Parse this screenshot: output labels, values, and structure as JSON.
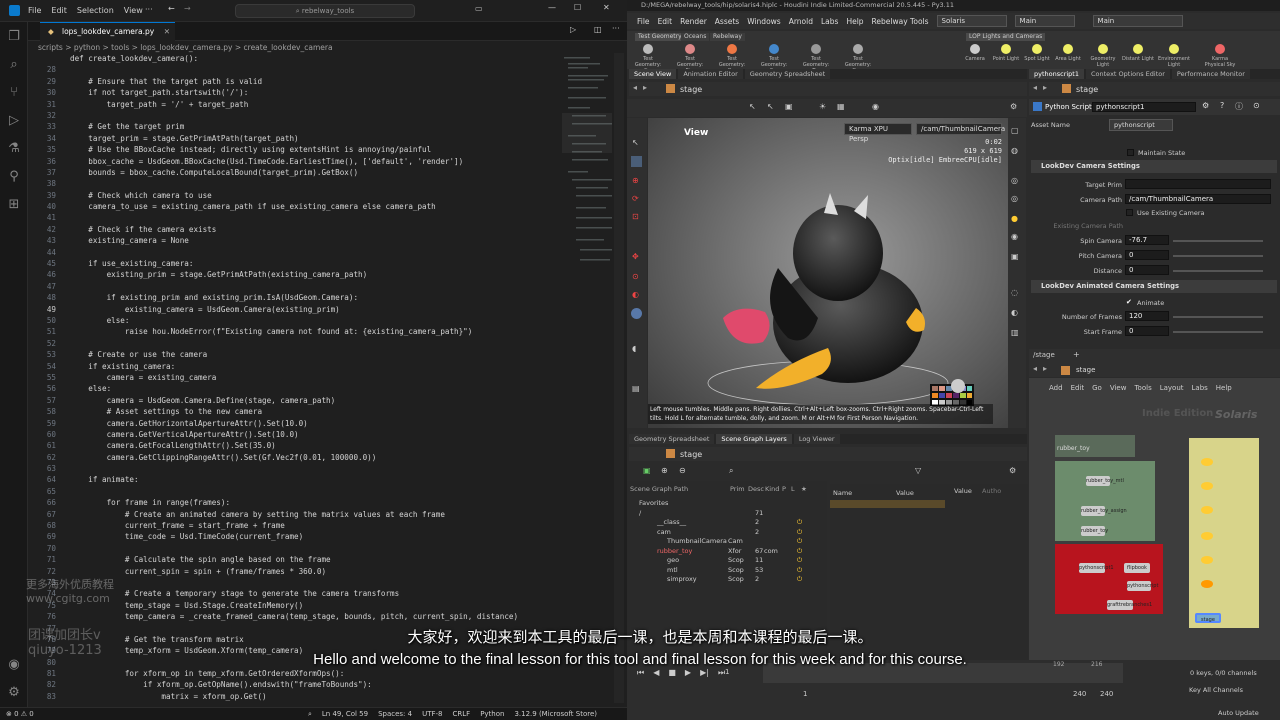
{
  "vscode": {
    "menu": [
      "File",
      "Edit",
      "Selection",
      "View"
    ],
    "search": "rebelway_tools",
    "tab": "lops_lookdev_camera.py",
    "breadcrumb": "scripts > python > tools > lops_lookdev_camera.py > create_lookdev_camera",
    "lines": [
      {
        "n": "",
        "t": "def create_lookdev_camera():"
      },
      {
        "n": "28",
        "t": ""
      },
      {
        "n": "29",
        "t": "    # Ensure that the target path is valid"
      },
      {
        "n": "30",
        "t": "    if not target_path.startswith('/'):"
      },
      {
        "n": "31",
        "t": "        target_path = '/' + target_path"
      },
      {
        "n": "32",
        "t": ""
      },
      {
        "n": "33",
        "t": "    # Get the target prim"
      },
      {
        "n": "34",
        "t": "    target_prim = stage.GetPrimAtPath(target_path)"
      },
      {
        "n": "35",
        "t": "    # Use the BBoxCache instead; directly using extentsHint is annoying/painful"
      },
      {
        "n": "36",
        "t": "    bbox_cache = UsdGeom.BBoxCache(Usd.TimeCode.EarliestTime(), ['default', 'render'])"
      },
      {
        "n": "37",
        "t": "    bounds = bbox_cache.ComputeLocalBound(target_prim).GetBox()"
      },
      {
        "n": "38",
        "t": ""
      },
      {
        "n": "39",
        "t": "    # Check which camera to use"
      },
      {
        "n": "40",
        "t": "    camera_to_use = existing_camera_path if use_existing_camera else camera_path"
      },
      {
        "n": "41",
        "t": ""
      },
      {
        "n": "42",
        "t": "    # Check if the camera exists"
      },
      {
        "n": "43",
        "t": "    existing_camera = None"
      },
      {
        "n": "44",
        "t": ""
      },
      {
        "n": "45",
        "t": "    if use_existing_camera:"
      },
      {
        "n": "46",
        "t": "        existing_prim = stage.GetPrimAtPath(existing_camera_path)"
      },
      {
        "n": "47",
        "t": ""
      },
      {
        "n": "48",
        "t": "        if existing_prim and existing_prim.IsA(UsdGeom.Camera):"
      },
      {
        "n": "49",
        "t": "            existing_camera = UsdGeom.Camera(existing_prim)"
      },
      {
        "n": "50",
        "t": "        else:"
      },
      {
        "n": "51",
        "t": "            raise hou.NodeError(f\"Existing camera not found at: {existing_camera_path}\")"
      },
      {
        "n": "52",
        "t": ""
      },
      {
        "n": "53",
        "t": "    # Create or use the camera"
      },
      {
        "n": "54",
        "t": "    if existing_camera:"
      },
      {
        "n": "55",
        "t": "        camera = existing_camera"
      },
      {
        "n": "56",
        "t": "    else:"
      },
      {
        "n": "57",
        "t": "        camera = UsdGeom.Camera.Define(stage, camera_path)"
      },
      {
        "n": "58",
        "t": "        # Asset settings to the new camera"
      },
      {
        "n": "59",
        "t": "        camera.GetHorizontalApertureAttr().Set(10.0)"
      },
      {
        "n": "60",
        "t": "        camera.GetVerticalApertureAttr().Set(10.0)"
      },
      {
        "n": "61",
        "t": "        camera.GetFocalLengthAttr().Set(35.0)"
      },
      {
        "n": "62",
        "t": "        camera.GetClippingRangeAttr().Set(Gf.Vec2f(0.01, 100000.0))"
      },
      {
        "n": "63",
        "t": ""
      },
      {
        "n": "64",
        "t": "    if animate:"
      },
      {
        "n": "65",
        "t": ""
      },
      {
        "n": "66",
        "t": "        for frame in range(frames):"
      },
      {
        "n": "67",
        "t": "            # Create an animated camera by setting the matrix values at each frame"
      },
      {
        "n": "68",
        "t": "            current_frame = start_frame + frame"
      },
      {
        "n": "69",
        "t": "            time_code = Usd.TimeCode(current_frame)"
      },
      {
        "n": "70",
        "t": ""
      },
      {
        "n": "71",
        "t": "            # Calculate the spin angle based on the frame"
      },
      {
        "n": "72",
        "t": "            current_spin = spin + (frame/frames * 360.0)"
      },
      {
        "n": "73",
        "t": ""
      },
      {
        "n": "74",
        "t": "            # Create a temporary stage to generate the camera transforms"
      },
      {
        "n": "75",
        "t": "            temp_stage = Usd.Stage.CreateInMemory()"
      },
      {
        "n": "76",
        "t": "            temp_camera = _create_framed_camera(temp_stage, bounds, pitch, current_spin, distance)"
      },
      {
        "n": "77",
        "t": ""
      },
      {
        "n": "78",
        "t": "            # Get the transform matrix"
      },
      {
        "n": "79",
        "t": "            temp_xform = UsdGeom.Xform(temp_camera)"
      },
      {
        "n": "80",
        "t": ""
      },
      {
        "n": "81",
        "t": "            for xform_op in temp_xform.GetOrderedXformOps():"
      },
      {
        "n": "82",
        "t": "                if xform_op.GetOpName().endswith(\"frameToBounds\"):"
      },
      {
        "n": "83",
        "t": "                    matrix = xform_op.Get()"
      }
    ],
    "status": {
      "left": "⊗ 0  ⚠ 0",
      "pos": "Ln 49, Col 59",
      "spaces": "Spaces: 4",
      "enc": "UTF-8",
      "eol": "CRLF",
      "lang": "Python",
      "ver": "3.12.9 (Microsoft Store)"
    }
  },
  "houdini": {
    "title": "D:/MEGA/rebelway_tools/hip/solaris4.hiplc - Houdini Indie Limited-Commercial 20.5.445 - Py3.11",
    "menu": [
      "File",
      "Edit",
      "Render",
      "Assets",
      "Windows",
      "Arnold",
      "Labs",
      "Help",
      "Rebelway Tools"
    ],
    "desk": "Solaris",
    "main": "Main",
    "main2": "Main",
    "shelf_tabs": [
      "Test Geometry",
      "Oceans",
      "Rebelway"
    ],
    "shelf_tabs2": [
      "LOP Lights and Cameras"
    ],
    "shelf_tools": [
      "Test Geometry: C...",
      "Test Geometry: Pi...",
      "Test Geometry: R...",
      "Test Geometry: S...",
      "Test Geometry: T...",
      "Test Geometry: Ge..."
    ],
    "shelf_tools2": [
      "Camera",
      "Point Light",
      "Spot Light",
      "Area Light",
      "Geometry Light",
      "Distant Light",
      "Environment Light",
      "Karma Physical Sky"
    ],
    "view_tabs": [
      "Scene View",
      "Animation Editor",
      "Geometry Spreadsheet"
    ],
    "stage": "stage",
    "vp": {
      "label": "View",
      "renderer": "Karma XPU Persp",
      "camera": "/cam/ThumbnailCamera",
      "time": "0:02",
      "res": "619 x 619",
      "status": "Optix[idle]  EmbreeCPU[idle]",
      "help": "Left mouse tumbles. Middle pans. Right dollies. Ctrl+Alt+Left box-zooms. Ctrl+Right zooms. Spacebar-Ctrl-Left tilts. Hold L for alternate tumble, dolly, and zoom. M or Alt+M for First Person Navigation."
    },
    "param_tabs": [
      "pythonscript1",
      "Context Options Editor",
      "Performance Monitor"
    ],
    "params": {
      "node_type": "Python Script",
      "node_name": "pythonscript1",
      "asset_name_label": "Asset Name",
      "asset_name": "pythonscript",
      "maintain_state": "Maintain State",
      "sec1": "LookDev Camera Settings",
      "target_prim_label": "Target Prim",
      "target_prim": "",
      "camera_path_label": "Camera Path",
      "camera_path": "/cam/ThumbnailCamera",
      "use_existing": "Use Existing Camera",
      "existing_path_label": "Existing Camera Path",
      "spin_label": "Spin Camera",
      "spin": "-76.7",
      "pitch_label": "Pitch Camera",
      "pitch": "0",
      "distance_label": "Distance",
      "distance": "0",
      "sec2": "LookDev Animated Camera Settings",
      "animate": "Animate",
      "frames_label": "Number of Frames",
      "frames": "120",
      "start_label": "Start Frame",
      "start": "0"
    },
    "sg_tabs": [
      "Geometry Spreadsheet",
      "Scene Graph Layers",
      "Log Viewer"
    ],
    "sg_header": [
      "Scene Graph Path",
      "Prim",
      "Desc",
      "Kind",
      "P",
      "L",
      "★"
    ],
    "sg_rows": [
      {
        "path": "Favorites",
        "prim": "",
        "desc": "",
        "kind": ""
      },
      {
        "path": "/",
        "prim": "",
        "desc": "71",
        "kind": ""
      },
      {
        "path": "__class__",
        "prim": "",
        "desc": "2",
        "kind": ""
      },
      {
        "path": "cam",
        "prim": "",
        "desc": "2",
        "kind": ""
      },
      {
        "path": "ThumbnailCamera",
        "prim": "Cam",
        "desc": "",
        "kind": ""
      },
      {
        "path": "rubber_toy",
        "prim": "Xfor",
        "desc": "67",
        "kind": "com"
      },
      {
        "path": "geo",
        "prim": "Scop",
        "desc": "11",
        "kind": ""
      },
      {
        "path": "mtl",
        "prim": "Scop",
        "desc": "53",
        "kind": ""
      },
      {
        "path": "simproxy",
        "prim": "Scop",
        "desc": "2",
        "kind": ""
      }
    ],
    "attr_header": [
      "Name",
      "Value",
      "Value",
      "Autho"
    ],
    "net_path": "/stage",
    "net_menu": [
      "Add",
      "Edit",
      "Go",
      "View",
      "Tools",
      "Layout",
      "Labs",
      "Help"
    ],
    "net_watermark": "Indie Edition",
    "net_context": "Solaris",
    "nodes": [
      "rubber_toy",
      "rubber_toy_mtl",
      "rubber_toy_assign",
      "rubber_toy",
      "pythonscript1",
      "flipbook",
      "pythonscript",
      "grafttrebranches1",
      "stage"
    ],
    "timeline": {
      "frame": "1",
      "start": "1",
      "end": "240",
      "end2": "240",
      "ticks": [
        "192",
        "216"
      ],
      "keys": "0 keys, 0/0 channels",
      "keyall": "Key All Channels",
      "autoupdate": "Auto Update"
    }
  },
  "subtitle": {
    "zh": "大家好，欢迎来到本工具的最后一课，也是本周和本课程的最后一课。",
    "en": "Hello and welcome to the final lesson for this tool and final lesson for this week and for this course."
  },
  "watermark": {
    "line1": "更多海外优质教程",
    "line2": "www.cgitg.com",
    "line3": "团课加团长v",
    "line4": "qiuyo-1213"
  }
}
